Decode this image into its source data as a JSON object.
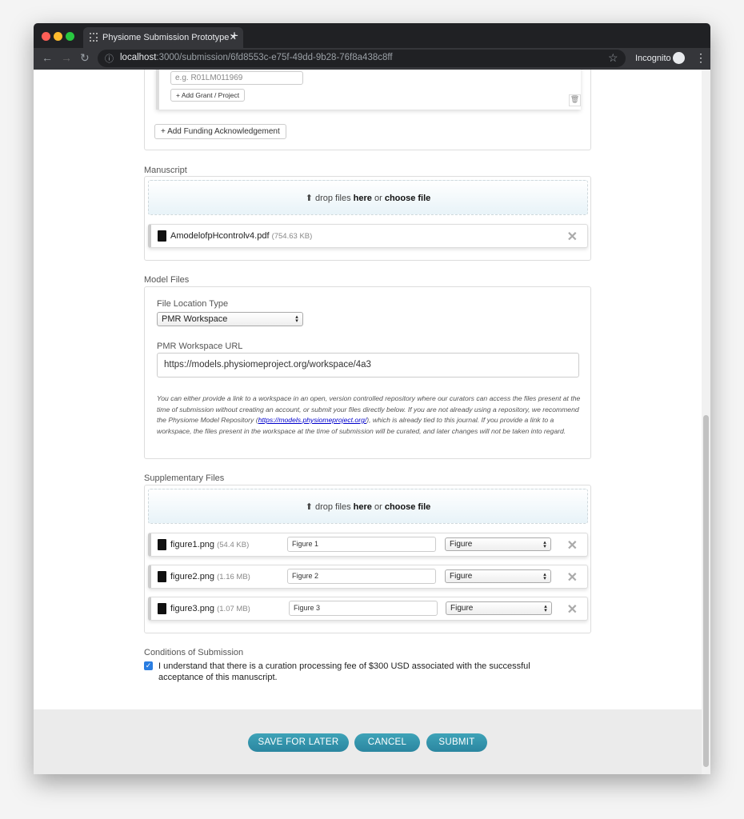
{
  "browser": {
    "tab_title": "Physiome Submission Prototype",
    "url_host": "localhost",
    "url_path": ":3000/submission/6fd8553c-e75f-49dd-9b28-76f8a438c8ff",
    "profile": "Incognito"
  },
  "funding": {
    "grant_placeholder": "e.g. R01LM011969",
    "add_grant": "+ Add Grant / Project",
    "add_funding": "+ Add Funding Acknowledgement"
  },
  "manuscript": {
    "label": "Manuscript",
    "drop": {
      "prefix": "drop files ",
      "here": "here",
      "or": " or ",
      "choose": "choose file"
    },
    "file": {
      "name": "AmodelofpHcontrolv4.pdf",
      "size": "(754.63 KB)"
    }
  },
  "model_files": {
    "label": "Model Files",
    "location_label": "File Location Type",
    "location_value": "PMR Workspace",
    "url_label": "PMR Workspace URL",
    "url_value": "https://models.physiomeproject.org/workspace/4a3",
    "help_before": "You can either provide a link to a workspace in an open, version controlled repository where our curators can access the files present at the time of submission without creating an account, or submit your files directly below. If you are not already using a repository, we recommend the Physiome Model Repository (",
    "help_link": "https://models.physiomeproject.org/",
    "help_after": "), which is already tied to this journal. If you provide a link to a workspace, the files present in the workspace at the time of submission will be curated, and later changes will not be taken into regard."
  },
  "supplementary": {
    "label": "Supplementary Files",
    "files": [
      {
        "name": "figure1.png",
        "size": "(54.4 KB)",
        "title": "Figure 1",
        "type": "Figure"
      },
      {
        "name": "figure2.png",
        "size": "(1.16 MB)",
        "title": "Figure 2",
        "type": "Figure"
      },
      {
        "name": "figure3.png",
        "size": "(1.07 MB)",
        "title": "Figure 3",
        "type": "Figure"
      }
    ]
  },
  "conditions": {
    "label": "Conditions of Submission",
    "checked": true,
    "text": "I understand that there is a curation processing fee of $300 USD associated with the successful acceptance of this manuscript."
  },
  "actions": {
    "save": "SAVE FOR LATER",
    "cancel": "CANCEL",
    "submit": "SUBMIT"
  }
}
